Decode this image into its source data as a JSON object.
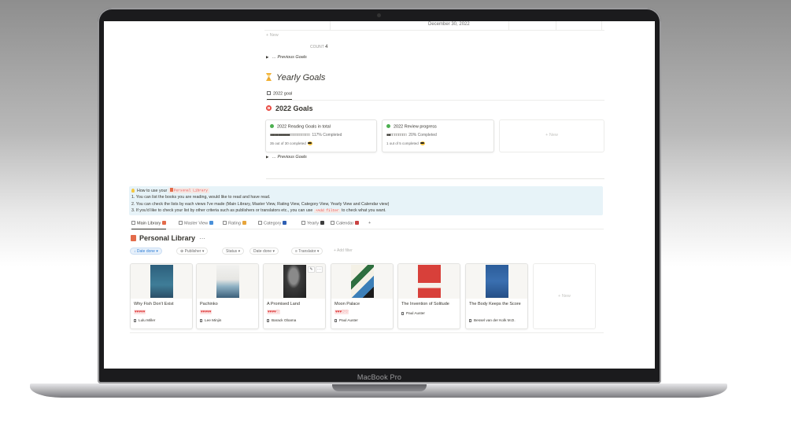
{
  "device": {
    "label": "MacBook Pro"
  },
  "top": {
    "date": "December 30, 2022",
    "new_label": "+ New",
    "count_label": "COUNT",
    "count_value": "4"
  },
  "previous_goals_1": "… Previous Goals",
  "yearly": {
    "title": "Yearly Goals",
    "tab": "2022 goal"
  },
  "goals": {
    "title": "2022 Goals",
    "cards": [
      {
        "title": "2022 Reading Goals in total",
        "bar": "■■■■■■■■■■□□□□□□□□□□",
        "percent": "117% Completed",
        "summary": "35 out of 30 completed"
      },
      {
        "title": "2022 Review progress",
        "bar": "■■□□□□□□□□",
        "percent": "20% Completed",
        "summary": "1 out of 5 completed"
      }
    ],
    "new_label": "+ New"
  },
  "previous_goals_2": "… Previous Goals",
  "callout": {
    "how_prefix": "How to use your",
    "chip": "Personal Library",
    "line1": "1. You can list the books you are reading, would like to read and have read.",
    "line2": "2. You can check the lists by each views I've made (Main Library, Master View, Rating View, Category View, Yearly View and Calendar view)",
    "line3_a": "3.  If you'd like to check your list by other criteria such as publishers or translators etc., you can use",
    "line3_chip": "+Add filter",
    "line3_b": "to check what you want."
  },
  "views": [
    "Main Library",
    "Master View",
    "Rating",
    "Category",
    "Yearly",
    "Calendar",
    "+"
  ],
  "library": {
    "title": "Personal Library",
    "more": "···",
    "filters": [
      "↓ Date done ▾",
      "⊕ Publisher ▾",
      "Status ▾",
      "Date done ▾",
      "≡ Translator ▾"
    ],
    "add_filter": "+ Add filter",
    "books": [
      {
        "title": "Why Fish Don't Exist",
        "rating": "♥♥♥♥♥",
        "author": "Lulu Miller"
      },
      {
        "title": "Pachinko",
        "rating": "♥♥♥♥♥",
        "author": "Lee Minjin"
      },
      {
        "title": "A Promised Land",
        "rating": "♥♥♥♥♡",
        "author": "Barack Obama"
      },
      {
        "title": "Moon Palace",
        "rating": "♥♥♥♡♡",
        "author": "Paul Auster"
      },
      {
        "title": "The Invention of Solitude",
        "rating": "",
        "author": "Paul Auster"
      },
      {
        "title": "The Body Keeps the Score",
        "rating": "",
        "author": "Bessel van der Kolk M.D."
      }
    ],
    "new_label": "+ New"
  },
  "colors": {
    "accent": "#2f7fd6",
    "callout_bg": "#e7f3f8",
    "heart": "#e03e3e",
    "text": "#37352f"
  }
}
